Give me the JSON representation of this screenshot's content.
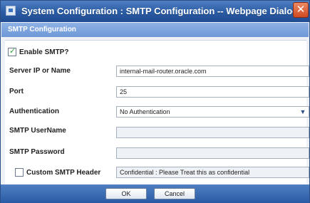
{
  "window": {
    "title": "System Configuration : SMTP Configuration -- Webpage Dialog",
    "close_symbol": "✕",
    "icon_name": "app-window-icon"
  },
  "header": {
    "title": "SMTP Configuration"
  },
  "form": {
    "enable_smtp": {
      "label": "Enable SMTP?",
      "checked": true
    },
    "server": {
      "label": "Server IP or Name",
      "value": "internal-mail-router.oracle.com"
    },
    "port": {
      "label": "Port",
      "value": "25"
    },
    "authentication": {
      "label": "Authentication",
      "selected": "No Authentication"
    },
    "smtp_username": {
      "label": "SMTP UserName",
      "value": ""
    },
    "smtp_password": {
      "label": "SMTP Password",
      "value": ""
    },
    "custom_header": {
      "label": "Custom SMTP Header",
      "checked": false,
      "value": "Confidential : Please Treat this as confidential"
    }
  },
  "buttons": {
    "ok": "OK",
    "cancel": "Cancel"
  },
  "colors": {
    "titlebar": "#2a5aa3",
    "header": "#7aa3dc",
    "panel": "#ffffff",
    "accent_check": "#2a9d3a"
  }
}
